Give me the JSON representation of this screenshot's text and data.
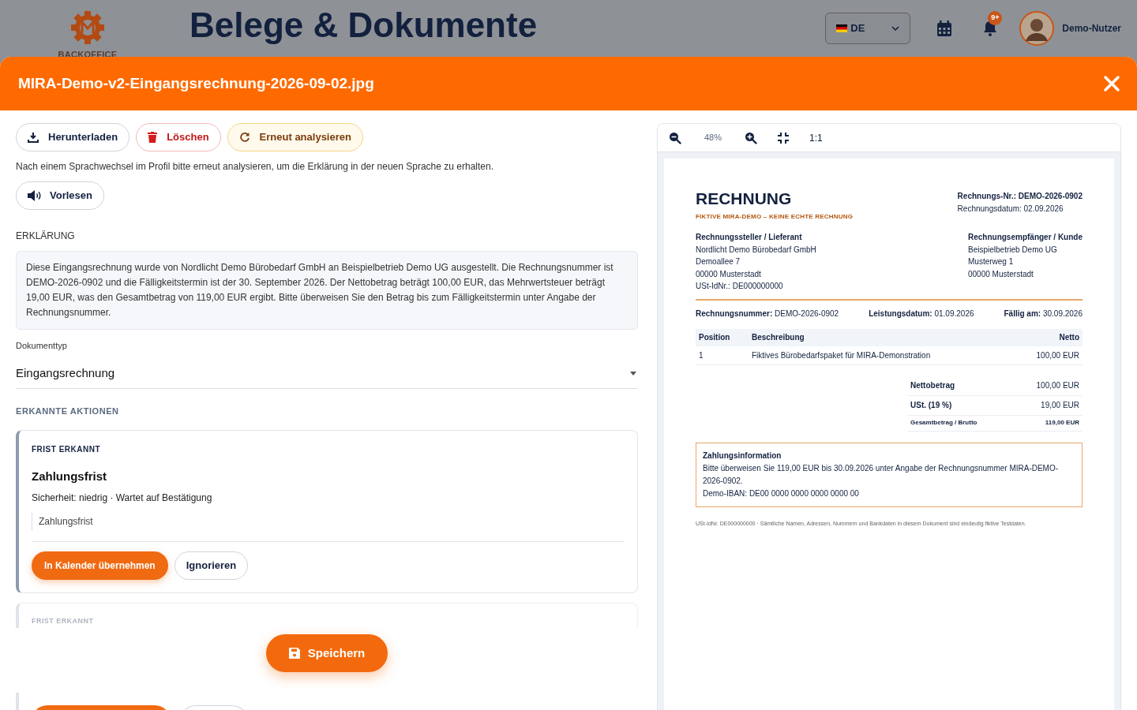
{
  "background": {
    "logo_text": "BACKOFFICE",
    "page_title": "Belege & Dokumente",
    "language": "DE",
    "notification_badge": "9+",
    "user_name": "Demo-Nutzer"
  },
  "modal": {
    "title": "MIRA-Demo-v2-Eingangsrechnung-2026-09-02.jpg",
    "toolbar": [
      {
        "kind": "download",
        "label": "Herunterladen"
      },
      {
        "kind": "delete",
        "label": "Löschen"
      },
      {
        "kind": "reanalyze",
        "label": "Erneut analysieren"
      }
    ],
    "hint": "Nach einem Sprachwechsel im Profil bitte erneut analysieren, um die Erklärung in der neuen Sprache zu erhalten.",
    "read_aloud": "Vorlesen",
    "explanation": {
      "label": "ERKLÄRUNG",
      "text": "Diese Eingangsrechnung wurde von Nordlicht Demo Bürobedarf GmbH an Beispielbetrieb Demo UG ausgestellt. Die Rechnungsnummer ist DEMO-2026-0902 und die Fälligkeitstermin ist der 30. September 2026. Der Nettobetrag beträgt 100,00 EUR, das Mehrwertsteuer beträgt 19,00 EUR, was den Gesamtbetrag von 119,00 EUR ergibt. Bitte überweisen Sie den Betrag bis zum Fälligkeitstermin unter Angabe der Rechnungsnummer."
    },
    "document_type": {
      "label": "Dokumenttyp",
      "value": "Eingangsrechnung"
    },
    "actions_heading": "ERKANNTE AKTIONEN",
    "actions": [
      {
        "type_label": "FRIST ERKANNT",
        "title": "Zahlungsfrist",
        "meta": "Sicherheit: niedrig · Wartet auf Bestätigung",
        "detail": "Zahlungsfrist",
        "primary": "In Kalender übernehmen",
        "secondary": "Ignorieren"
      }
    ],
    "faded_action": {
      "type_label": "FRIST ERKANNT"
    },
    "save": "Speichern"
  },
  "viewer": {
    "zoom": "48%",
    "actual_size": "1:1",
    "document": {
      "title": "RECHNUNG",
      "subtitle": "FIKTIVE MIRA-DEMO – KEINE ECHTE RECHNUNG",
      "number_line": "Rechnungs-Nr.: DEMO-2026-0902",
      "date_line": "Rechnungsdatum: 02.09.2026",
      "parties": [
        {
          "heading": "Rechnungssteller / Lieferant",
          "lines": [
            "Nordlicht Demo Bürobedarf GmbH",
            "Demoallee 7",
            "00000 Musterstadt",
            "USt-IdNr.: DE000000000"
          ]
        },
        {
          "heading": "Rechnungsempfänger / Kunde",
          "lines": [
            "Beispielbetrieb Demo UG",
            "Musterweg 1",
            "00000 Musterstadt"
          ]
        }
      ],
      "meta": [
        "**Rechnungsnummer:** DEMO-2026-0902",
        "**Leistungsdatum:** 01.09.2026",
        "**Fällig am:** 30.09.2026"
      ],
      "columns": [
        "Position",
        "Beschreibung",
        "Netto"
      ],
      "rows": [
        [
          "1",
          "Fiktives Bürobedarfspaket für MIRA-Demonstration",
          "100,00 EUR"
        ]
      ],
      "totals": [
        {
          "kind": "normal",
          "label": "Nettobetrag",
          "value": "100,00 EUR"
        },
        {
          "kind": "normal",
          "label": "USt. (19 %)",
          "value": "19,00 EUR"
        },
        {
          "kind": "small",
          "label": "Gesamtbetrag / Brutto",
          "value": "119,00 EUR"
        }
      ],
      "payment": {
        "heading": "Zahlungsinformation",
        "lines": [
          "Bitte überweisen Sie 119,00 EUR bis 30.09.2026 unter Angabe der Rechnungsnummer MIRA-DEMO-2026-0902.",
          "Demo-IBAN: DE00 0000 0000 0000 0000 00"
        ]
      },
      "footer": "USt-IdNr. DE000000000 · Sämtliche Namen, Adressen, Nummern und Bankdaten in diesem Dokument sind eindeutig fiktive Testdaten."
    }
  }
}
